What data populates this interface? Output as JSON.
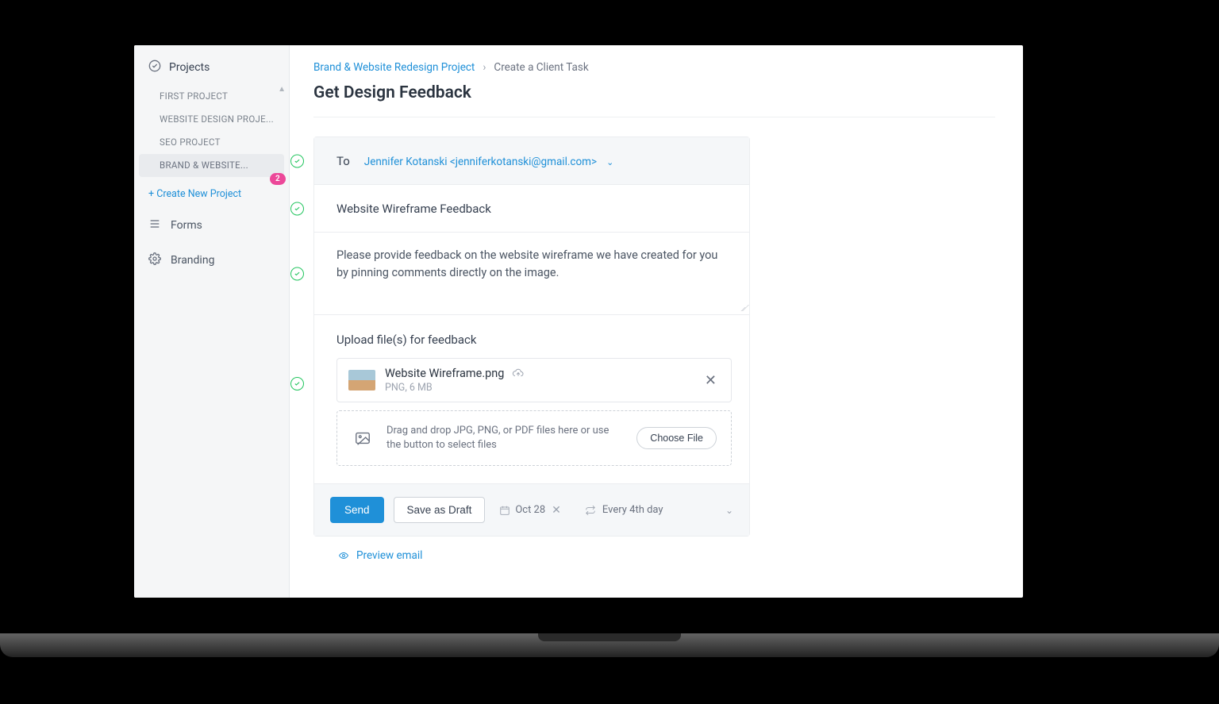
{
  "sidebar": {
    "header": "Projects",
    "projects": [
      "FIRST PROJECT",
      "WEBSITE DESIGN PROJE...",
      "SEO PROJECT",
      "BRAND & WEBSITE..."
    ],
    "badge": "2",
    "new_project": "+ Create New Project",
    "nav_forms": "Forms",
    "nav_branding": "Branding"
  },
  "breadcrumb": {
    "parent": "Brand & Website Redesign Project",
    "current": "Create a Client Task"
  },
  "page_title": "Get Design Feedback",
  "form": {
    "to_label": "To",
    "recipient": "Jennifer Kotanski <jenniferkotanski@gmail.com>",
    "subject": "Website Wireframe Feedback",
    "body": "Please provide feedback on the website wireframe we have created for you by pinning comments directly on the image.",
    "upload_title": "Upload file(s) for feedback",
    "file": {
      "name": "Website Wireframe.png",
      "meta": "PNG, 6 MB"
    },
    "dropzone_text": "Drag and drop JPG, PNG, or PDF files here or use the button to select files",
    "choose_label": "Choose File"
  },
  "actions": {
    "send": "Send",
    "save_draft": "Save as Draft",
    "date": "Oct 28",
    "repeat": "Every 4th day",
    "preview": "Preview email"
  }
}
